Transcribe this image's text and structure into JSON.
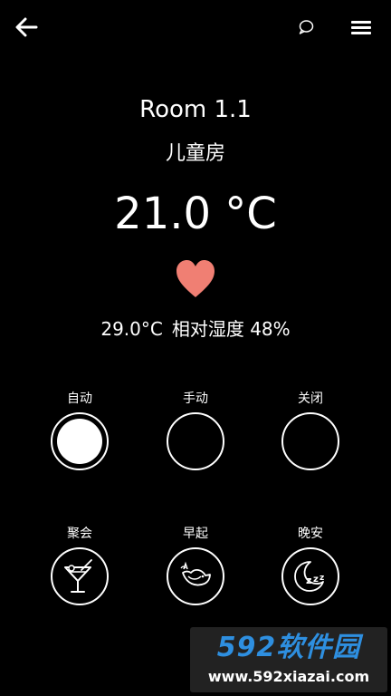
{
  "header": {
    "back_icon": "arrow-left-icon",
    "chat_icon": "chat-bubble-icon",
    "menu_icon": "hamburger-menu-icon"
  },
  "room": {
    "name": "Room 1.1",
    "subtitle": "儿童房",
    "temperature": "21.0 °C",
    "status_icon": "heart-icon",
    "status_color": "#f07f73",
    "actual_temp": "29.0°C",
    "humidity": "相对湿度 48%"
  },
  "modes": [
    {
      "label": "自动",
      "selected": true
    },
    {
      "label": "手动",
      "selected": false
    },
    {
      "label": "关闭",
      "selected": false
    }
  ],
  "scenes": [
    {
      "label": "聚会",
      "icon": "cocktail-icon"
    },
    {
      "label": "早起",
      "icon": "bird-icon"
    },
    {
      "label": "晚安",
      "icon": "sleep-moon-icon"
    }
  ],
  "watermark": {
    "logo": "592软件园",
    "url": "www.592xiazai.com",
    "logo_color": "#2e8fe0"
  }
}
